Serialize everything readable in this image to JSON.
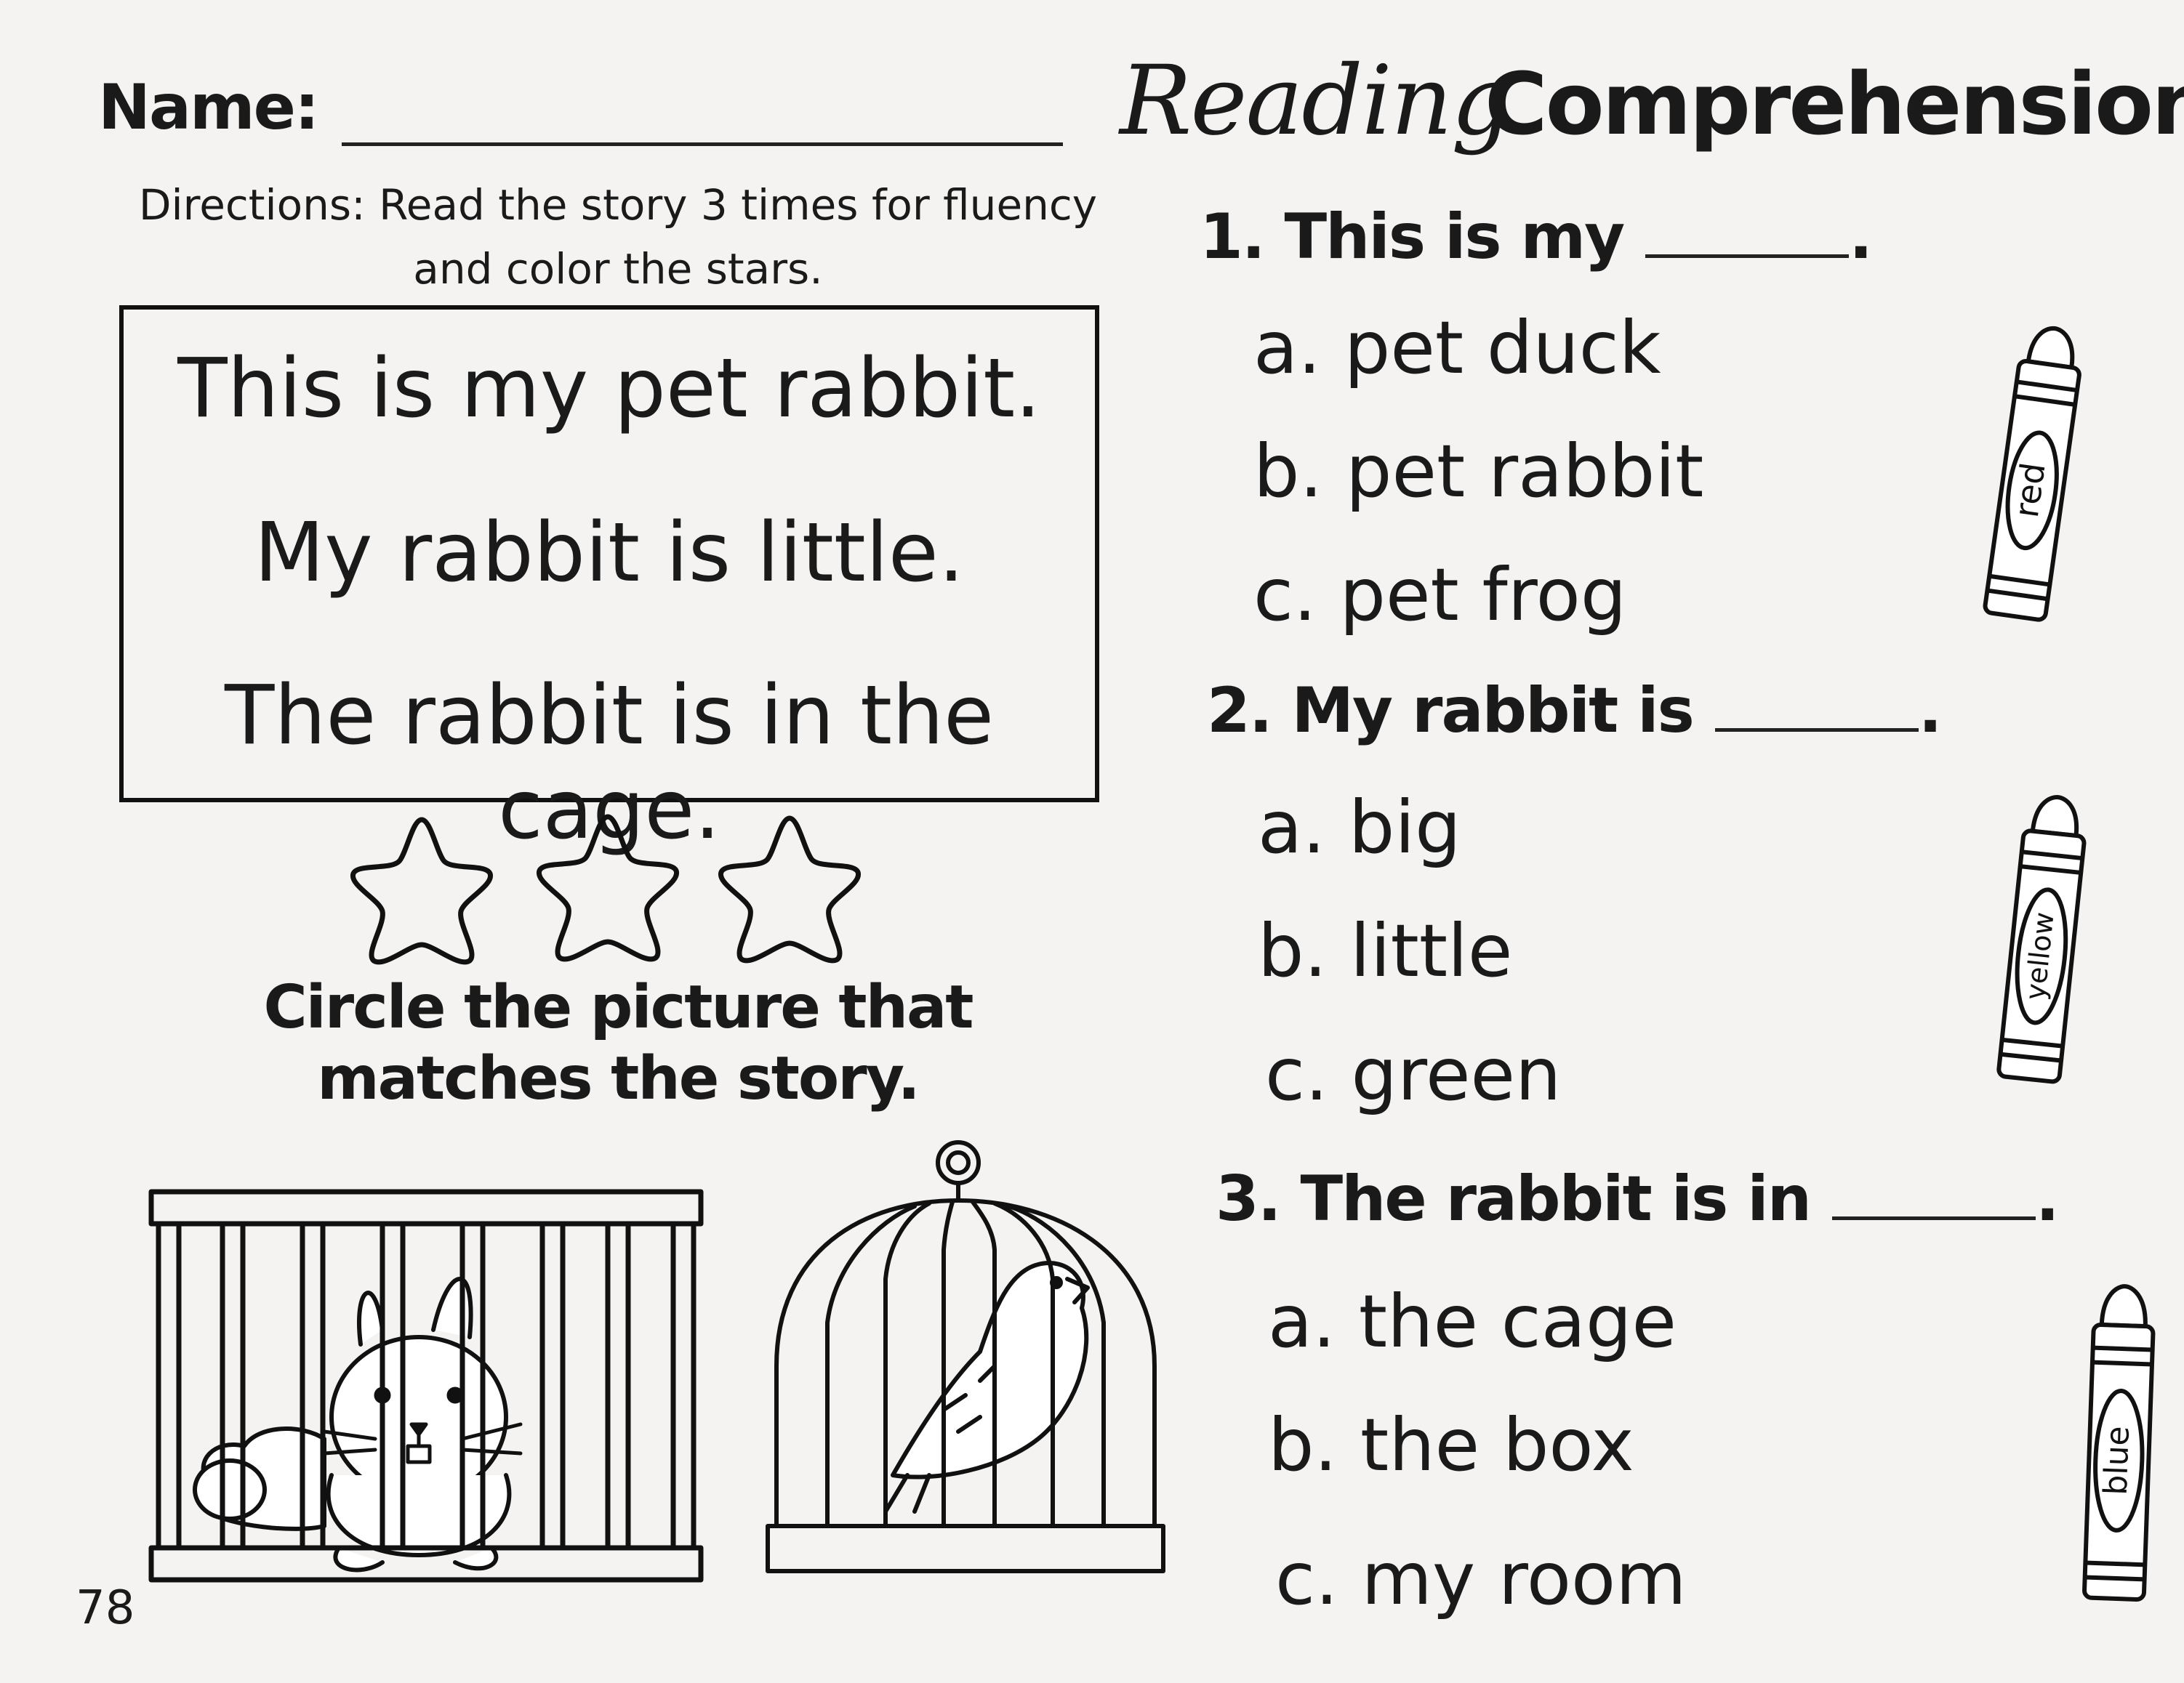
{
  "header": {
    "name_label": "Name:",
    "title_script": "Reading",
    "title_bold": "Comprehension"
  },
  "directions": {
    "line1": "Directions: Read the story 3 times for fluency",
    "line2": "and color the stars."
  },
  "story": {
    "lines": [
      "This is my pet rabbit.",
      "My rabbit is little.",
      "The rabbit is in the cage."
    ]
  },
  "circle_instructions": {
    "line1": "Circle the picture that",
    "line2": "matches the story."
  },
  "page_number": "78",
  "questions": [
    {
      "prompt": "1. This is my",
      "end": ".",
      "choices": [
        "a. pet duck",
        "b. pet rabbit",
        "c. pet frog"
      ],
      "crayon_label": "red"
    },
    {
      "prompt": "2. My rabbit is",
      "end": ".",
      "choices": [
        "a. big",
        "b. little",
        "c. green"
      ],
      "crayon_label": "yellow"
    },
    {
      "prompt": "3. The rabbit is in",
      "end": ".",
      "choices": [
        "a. the cage",
        "b. the box",
        "c. my room"
      ],
      "crayon_label": "blue"
    }
  ],
  "icons": {
    "star": "star-outline-icon",
    "crayon": "crayon-icon",
    "rabbit_cage": "rabbit-in-cage-picture",
    "bird_cage": "bird-in-cage-picture"
  }
}
